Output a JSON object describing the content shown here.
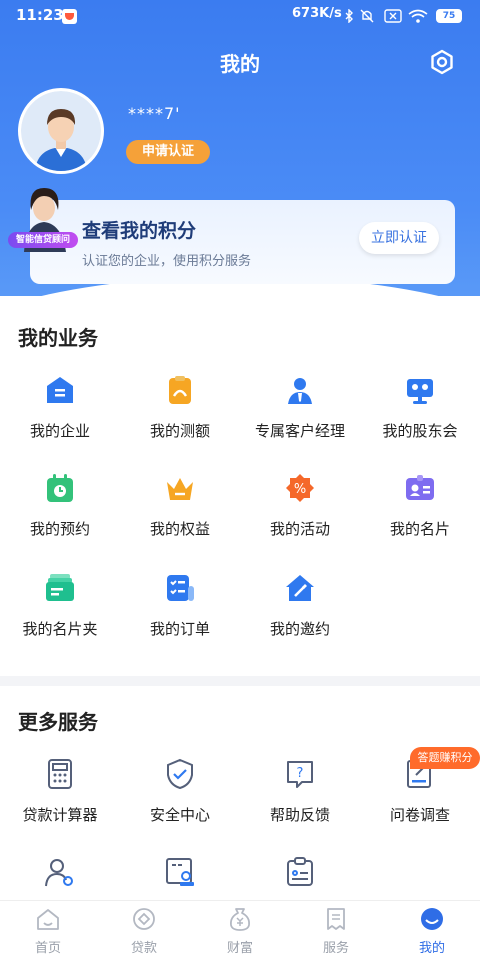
{
  "status_bar": {
    "time": "11:23",
    "network_speed": "673K/s",
    "battery": "75"
  },
  "header": {
    "title": "我的",
    "username": "****7'",
    "apply_badge": "申请认证"
  },
  "points_card": {
    "title": "查看我的积分",
    "subtitle": "认证您的企业，使用积分服务",
    "button": "立即认证",
    "advisor_label": "智能信贷顾问"
  },
  "business": {
    "title": "我的业务",
    "items": [
      {
        "label": "我的企业",
        "icon": "enterprise-icon"
      },
      {
        "label": "我的测额",
        "icon": "quota-test-icon"
      },
      {
        "label": "专属客户经理",
        "icon": "account-manager-icon"
      },
      {
        "label": "我的股东会",
        "icon": "shareholder-meeting-icon"
      },
      {
        "label": "我的预约",
        "icon": "appointment-icon"
      },
      {
        "label": "我的权益",
        "icon": "crown-icon"
      },
      {
        "label": "我的活动",
        "icon": "activity-icon"
      },
      {
        "label": "我的名片",
        "icon": "business-card-icon"
      },
      {
        "label": "我的名片夹",
        "icon": "card-holder-icon"
      },
      {
        "label": "我的订单",
        "icon": "order-icon"
      },
      {
        "label": "我的邀约",
        "icon": "invitation-icon"
      }
    ]
  },
  "more": {
    "title": "更多服务",
    "bonus_badge": "答题赚积分",
    "items": [
      {
        "label": "贷款计算器",
        "icon": "calculator-icon"
      },
      {
        "label": "安全中心",
        "icon": "shield-icon"
      },
      {
        "label": "帮助反馈",
        "icon": "help-icon"
      },
      {
        "label": "问卷调查",
        "icon": "survey-icon"
      },
      {
        "label": "",
        "icon": "people-icon"
      },
      {
        "label": "",
        "icon": "profile-card-icon"
      },
      {
        "label": "",
        "icon": "clipboard-icon"
      }
    ]
  },
  "tabbar": {
    "active": "我的",
    "items": [
      {
        "label": "首页",
        "icon": "home-icon"
      },
      {
        "label": "贷款",
        "icon": "loan-icon"
      },
      {
        "label": "财富",
        "icon": "wealth-icon"
      },
      {
        "label": "服务",
        "icon": "service-icon"
      },
      {
        "label": "我的",
        "icon": "mine-icon"
      }
    ]
  },
  "colors": {
    "primary": "#3b7cf0",
    "accent_orange": "#f5a139",
    "badge_red": "#ff6b2b"
  }
}
